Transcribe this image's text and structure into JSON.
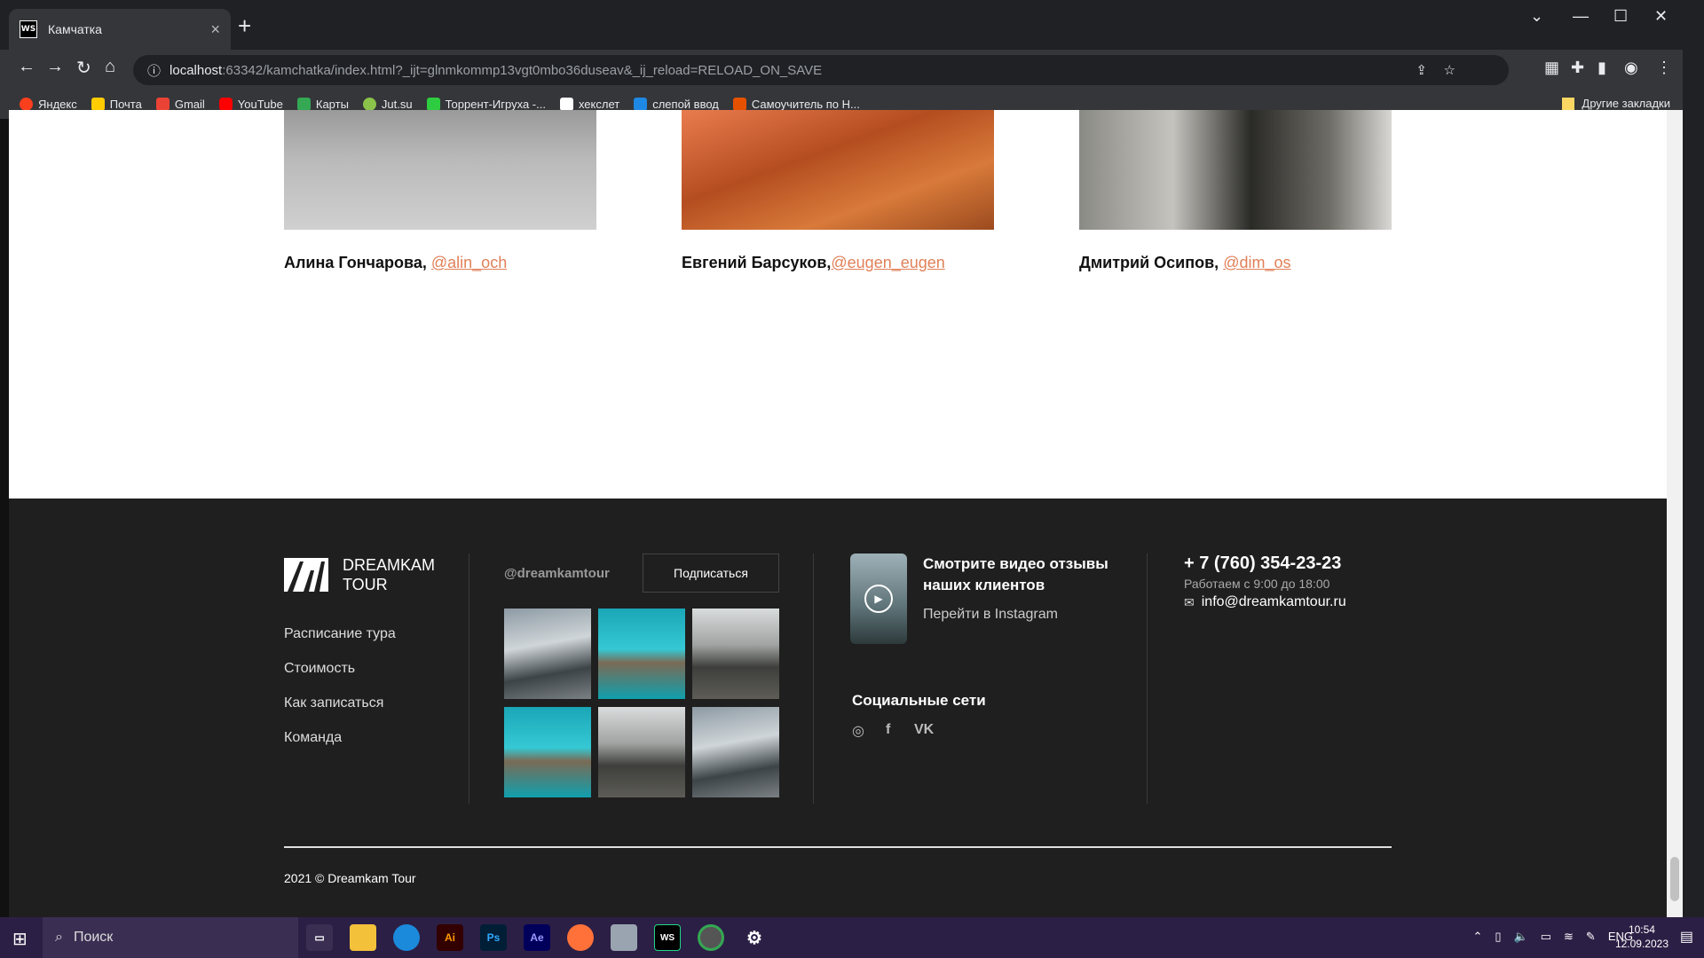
{
  "browser": {
    "tab_title": "Камчатка",
    "favicon_text": "WS",
    "url_host": "localhost",
    "url_rest": ":63342/kamchatka/index.html?_ijt=glnmkommp13vgt0mbo36duseav&_ij_reload=RELOAD_ON_SAVE",
    "bookmarks": [
      {
        "label": "Яндекс",
        "color": "#fc3f1d"
      },
      {
        "label": "Почта",
        "color": "#ffcc00"
      },
      {
        "label": "Gmail",
        "color": "#ea4335"
      },
      {
        "label": "YouTube",
        "color": "#ff0000"
      },
      {
        "label": "Карты",
        "color": "#34a853"
      },
      {
        "label": "Jut.su",
        "color": "#8bc34a"
      },
      {
        "label": "Торрент-Игруха -...",
        "color": "#2ecc40"
      },
      {
        "label": "хекслет",
        "color": "#ffffff"
      },
      {
        "label": "слепой ввод",
        "color": "#1e88e5"
      },
      {
        "label": "Самоучитель по Н...",
        "color": "#e65100"
      }
    ],
    "other_bookmarks": "Другие закладки"
  },
  "team": [
    {
      "name": "Алина Гончарова,",
      "handle": "@alin_och"
    },
    {
      "name": "Евгений Барсуков,",
      "handle": "@eugen_eugen"
    },
    {
      "name": "Дмитрий Осипов,",
      "handle": "@dim_os"
    }
  ],
  "footer": {
    "logo_line1": "DREAMKAM",
    "logo_line2": "TOUR",
    "nav": [
      "Расписание тура",
      "Стоимость",
      "Как записаться",
      "Команда"
    ],
    "instagram_handle": "@dreamkamtour",
    "subscribe": "Подписаться",
    "video_title": "Смотрите видео отзывы наших клиентов",
    "video_link": "Перейти в Instagram",
    "social_title": "Социальные сети",
    "phone": "+ 7 (760) 354-23-23",
    "hours": "Работаем с 9:00 до 18:00",
    "email": "info@dreamkamtour.ru",
    "copyright": "2021 © Dreamkam Tour"
  },
  "taskbar": {
    "search_placeholder": "Поиск",
    "lang": "ENG",
    "time": "10:54",
    "date": "12.09.2023"
  }
}
